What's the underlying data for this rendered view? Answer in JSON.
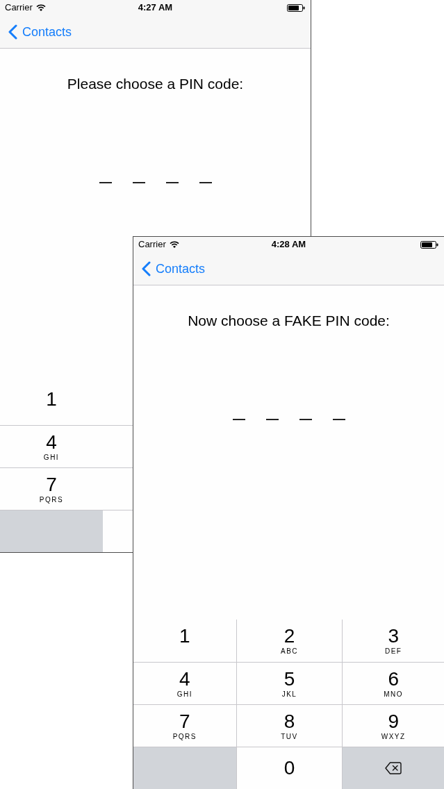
{
  "screens": [
    {
      "status_bar": {
        "carrier": "Carrier",
        "time": "4:27 AM"
      },
      "nav": {
        "back": "Contacts"
      },
      "prompt": "Please choose a PIN code:",
      "pin_slots": [
        {
          "filled": false
        },
        {
          "filled": false
        },
        {
          "filled": false
        },
        {
          "filled": false
        }
      ],
      "keypad": [
        [
          {
            "kind": "digit",
            "digit": "1"
          }
        ],
        [
          {
            "kind": "digit",
            "digit": "4",
            "letters": "GHI"
          }
        ],
        [
          {
            "kind": "digit",
            "digit": "7",
            "letters": "PQRS"
          }
        ],
        [
          {
            "kind": "blank"
          }
        ]
      ]
    },
    {
      "status_bar": {
        "carrier": "Carrier",
        "time": "4:28 AM"
      },
      "nav": {
        "back": "Contacts"
      },
      "prompt": "Now choose a FAKE PIN code:",
      "pin_slots": [
        {
          "filled": false
        },
        {
          "filled": false
        },
        {
          "filled": false
        },
        {
          "filled": false
        }
      ],
      "keypad": [
        [
          {
            "kind": "digit",
            "digit": "1"
          },
          {
            "kind": "digit",
            "digit": "2",
            "letters": "ABC"
          },
          {
            "kind": "digit",
            "digit": "3",
            "letters": "DEF"
          }
        ],
        [
          {
            "kind": "digit",
            "digit": "4",
            "letters": "GHI"
          },
          {
            "kind": "digit",
            "digit": "5",
            "letters": "JKL"
          },
          {
            "kind": "digit",
            "digit": "6",
            "letters": "MNO"
          }
        ],
        [
          {
            "kind": "digit",
            "digit": "7",
            "letters": "PQRS"
          },
          {
            "kind": "digit",
            "digit": "8",
            "letters": "TUV"
          },
          {
            "kind": "digit",
            "digit": "9",
            "letters": "WXYZ"
          }
        ],
        [
          {
            "kind": "blank"
          },
          {
            "kind": "digit",
            "digit": "0"
          },
          {
            "kind": "delete"
          }
        ]
      ]
    }
  ]
}
